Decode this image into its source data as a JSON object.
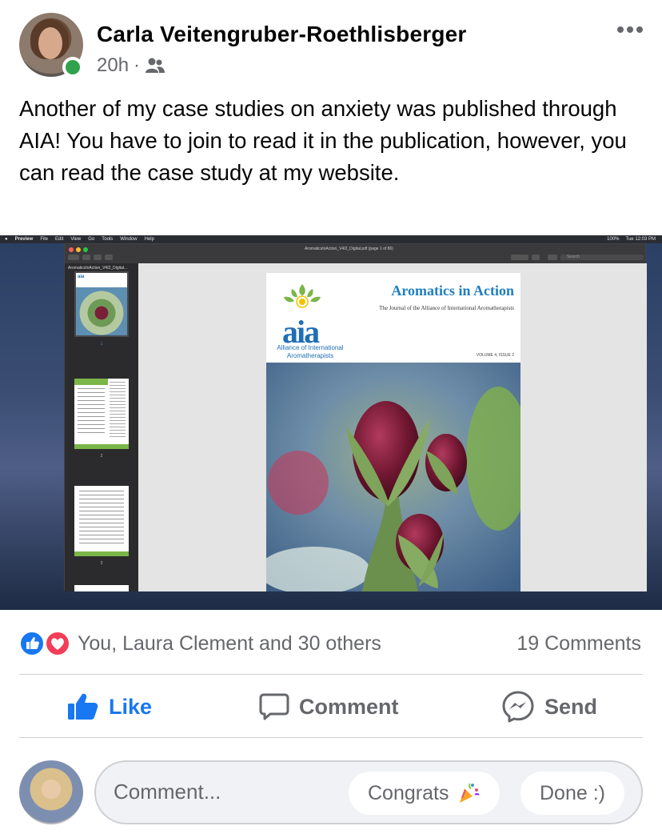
{
  "post": {
    "author": "Carla Veitengruber-Roethlisberger",
    "time": "20h",
    "separator": "·",
    "audience_icon": "friends-icon",
    "more_icon": "more-options-icon",
    "text": "Another of my case studies on anxiety was published through AIA!  You have to join to read it in the publication, however, you can read the case study at my website."
  },
  "screenshot": {
    "menubar": {
      "app": "Preview",
      "items": [
        "File",
        "Edit",
        "View",
        "Go",
        "Tools",
        "Window",
        "Help"
      ],
      "battery": "100%",
      "clock": "Tue 12:03 PM"
    },
    "window_title": "AromaticsInAction_V4I2_Digital.pdf (page 1 of 86)",
    "sidebar_title": "AromaticsInAction_V4I2_Digital...",
    "thumb_numbers": [
      "1",
      "2",
      "3"
    ],
    "search_placeholder": "Search",
    "cover": {
      "logo": "aia",
      "org_name": "Alliance of International Aromatherapists",
      "title": "Aromatics in Action",
      "subtitle": "The Journal of the Alliance of International Aromatherapists",
      "volume": "VOLUME 4, ISSUE 2"
    }
  },
  "reactions": {
    "names": "You, Laura Clement and 30 others",
    "comments": "19 Comments",
    "icons": [
      "like-reaction-icon",
      "love-reaction-icon"
    ]
  },
  "actions": {
    "like": "Like",
    "comment": "Comment",
    "send": "Send"
  },
  "composer": {
    "placeholder": "Comment...",
    "suggestion_1": "Congrats",
    "suggestion_2": "Done :)"
  },
  "colors": {
    "facebook_blue": "#1877f2",
    "online_green": "#31a24c",
    "secondary_text": "#65676b"
  }
}
